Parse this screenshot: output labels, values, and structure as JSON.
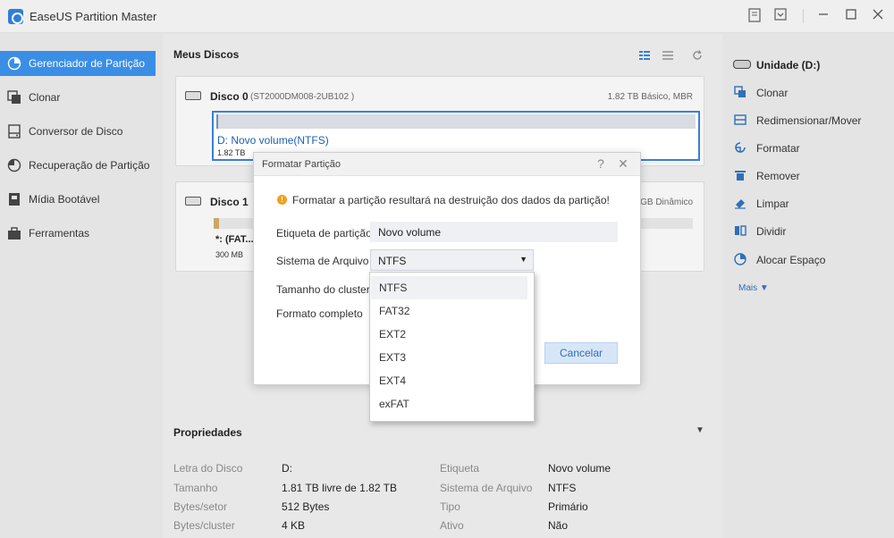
{
  "app": {
    "title": "EaseUS Partition Master"
  },
  "titlebar_icons": [
    "feedback-icon",
    "download-icon",
    "minimize-icon",
    "maximize-icon",
    "close-icon"
  ],
  "sidebar": {
    "items": [
      {
        "label": "Gerenciador de Partição",
        "icon": "disk-manager-icon",
        "active": true
      },
      {
        "label": "Clonar",
        "icon": "clone-icon"
      },
      {
        "label": "Conversor de Disco",
        "icon": "converter-icon"
      },
      {
        "label": "Recuperação de Partição",
        "icon": "recovery-icon"
      },
      {
        "label": "Mídia Bootável",
        "icon": "bootable-icon"
      },
      {
        "label": "Ferramentas",
        "icon": "toolbox-icon"
      }
    ]
  },
  "main": {
    "title": "Meus Discos",
    "disk0": {
      "name": "Disco 0",
      "model": "(ST2000DM008-2UB102 )",
      "info": "1.82 TB Básico, MBR",
      "partition": {
        "label": "D: Novo volume(NTFS)",
        "size": "1.82 TB"
      }
    },
    "disk1": {
      "name": "Disco 1",
      "info": "GB Dinâmico",
      "partition": {
        "label": "*: (FAT...",
        "size": "300 MB"
      }
    },
    "properties": {
      "title": "Propriedades",
      "left": [
        {
          "key": "Letra do Disco",
          "value": "D:"
        },
        {
          "key": "Tamanho",
          "value": "1.81 TB livre de 1.82 TB"
        },
        {
          "key": "Bytes/setor",
          "value": "512 Bytes"
        },
        {
          "key": "Bytes/cluster",
          "value": "4 KB"
        }
      ],
      "right": [
        {
          "key": "Etiqueta",
          "value": "Novo volume"
        },
        {
          "key": "Sistema de Arquivo",
          "value": "NTFS"
        },
        {
          "key": "Tipo",
          "value": "Primário"
        },
        {
          "key": "Ativo",
          "value": "Não"
        }
      ]
    }
  },
  "right_panel": {
    "unit": "Unidade (D:)",
    "actions": [
      {
        "label": "Clonar",
        "icon": "clone-icon"
      },
      {
        "label": "Redimensionar/Mover",
        "icon": "resize-icon"
      },
      {
        "label": "Formatar",
        "icon": "format-icon"
      },
      {
        "label": "Remover",
        "icon": "trash-icon"
      },
      {
        "label": "Limpar",
        "icon": "eraser-icon"
      },
      {
        "label": "Dividir",
        "icon": "split-icon"
      },
      {
        "label": "Alocar Espaço",
        "icon": "allocate-icon"
      }
    ],
    "more": "Mais"
  },
  "dialog": {
    "title": "Formatar Partição",
    "warning": "Formatar a partição resultará na destruição dos dados da partição!",
    "label_partition": "Etiqueta de partição",
    "partition_value": "Novo volume",
    "label_fs": "Sistema de Arquivo",
    "fs_value": "NTFS",
    "label_cluster": "Tamanho do cluster",
    "label_full": "Formato completo",
    "cancel": "Cancelar"
  },
  "dropdown": {
    "options": [
      "NTFS",
      "FAT32",
      "EXT2",
      "EXT3",
      "EXT4",
      "exFAT"
    ],
    "selected": "NTFS"
  },
  "colors": {
    "accent": "#3a8ee6",
    "link": "#2f6fb8",
    "warning": "#f0a020"
  }
}
